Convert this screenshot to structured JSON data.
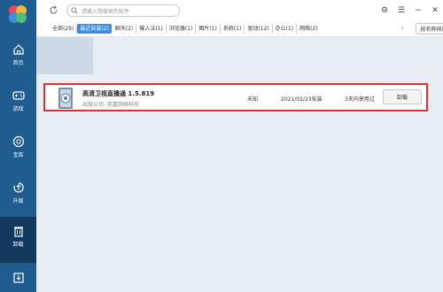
{
  "sidebar": {
    "items": [
      {
        "label": "首页",
        "icon": "home-icon"
      },
      {
        "label": "游戏",
        "icon": "gamepad-icon"
      },
      {
        "label": "宝库",
        "icon": "treasure-icon"
      },
      {
        "label": "升级",
        "icon": "upgrade-icon"
      },
      {
        "label": "卸载",
        "icon": "trash-icon"
      },
      {
        "label": "",
        "icon": "download-icon"
      }
    ]
  },
  "search": {
    "placeholder": "请输入想搜索的软件"
  },
  "tabs": [
    {
      "label": "全部(29)"
    },
    {
      "label": "最近安装(2)"
    },
    {
      "label": "聊天(2)"
    },
    {
      "label": "输入法(1)"
    },
    {
      "label": "浏览器(1)"
    },
    {
      "label": "图片(1)"
    },
    {
      "label": "系统(1)"
    },
    {
      "label": "驱动(12)"
    },
    {
      "label": "办公(1)"
    },
    {
      "label": "网络(2)"
    }
  ],
  "sort": {
    "label": "按名称排序"
  },
  "app": {
    "name": "高清卫视直播通 1.5.819",
    "publisher": "出版公司: 奕嘉网络科技",
    "size": "未知",
    "install_date": "2021/02/23安装",
    "usage": "3天内使用过",
    "uninstall_label": "卸载"
  },
  "colors": {
    "sidebar": "#1f5c8f",
    "sidebar_active": "#123a5e",
    "tab_active": "#3b8ee0",
    "highlight_border": "#e03030",
    "content_bg": "#e9eef4"
  }
}
